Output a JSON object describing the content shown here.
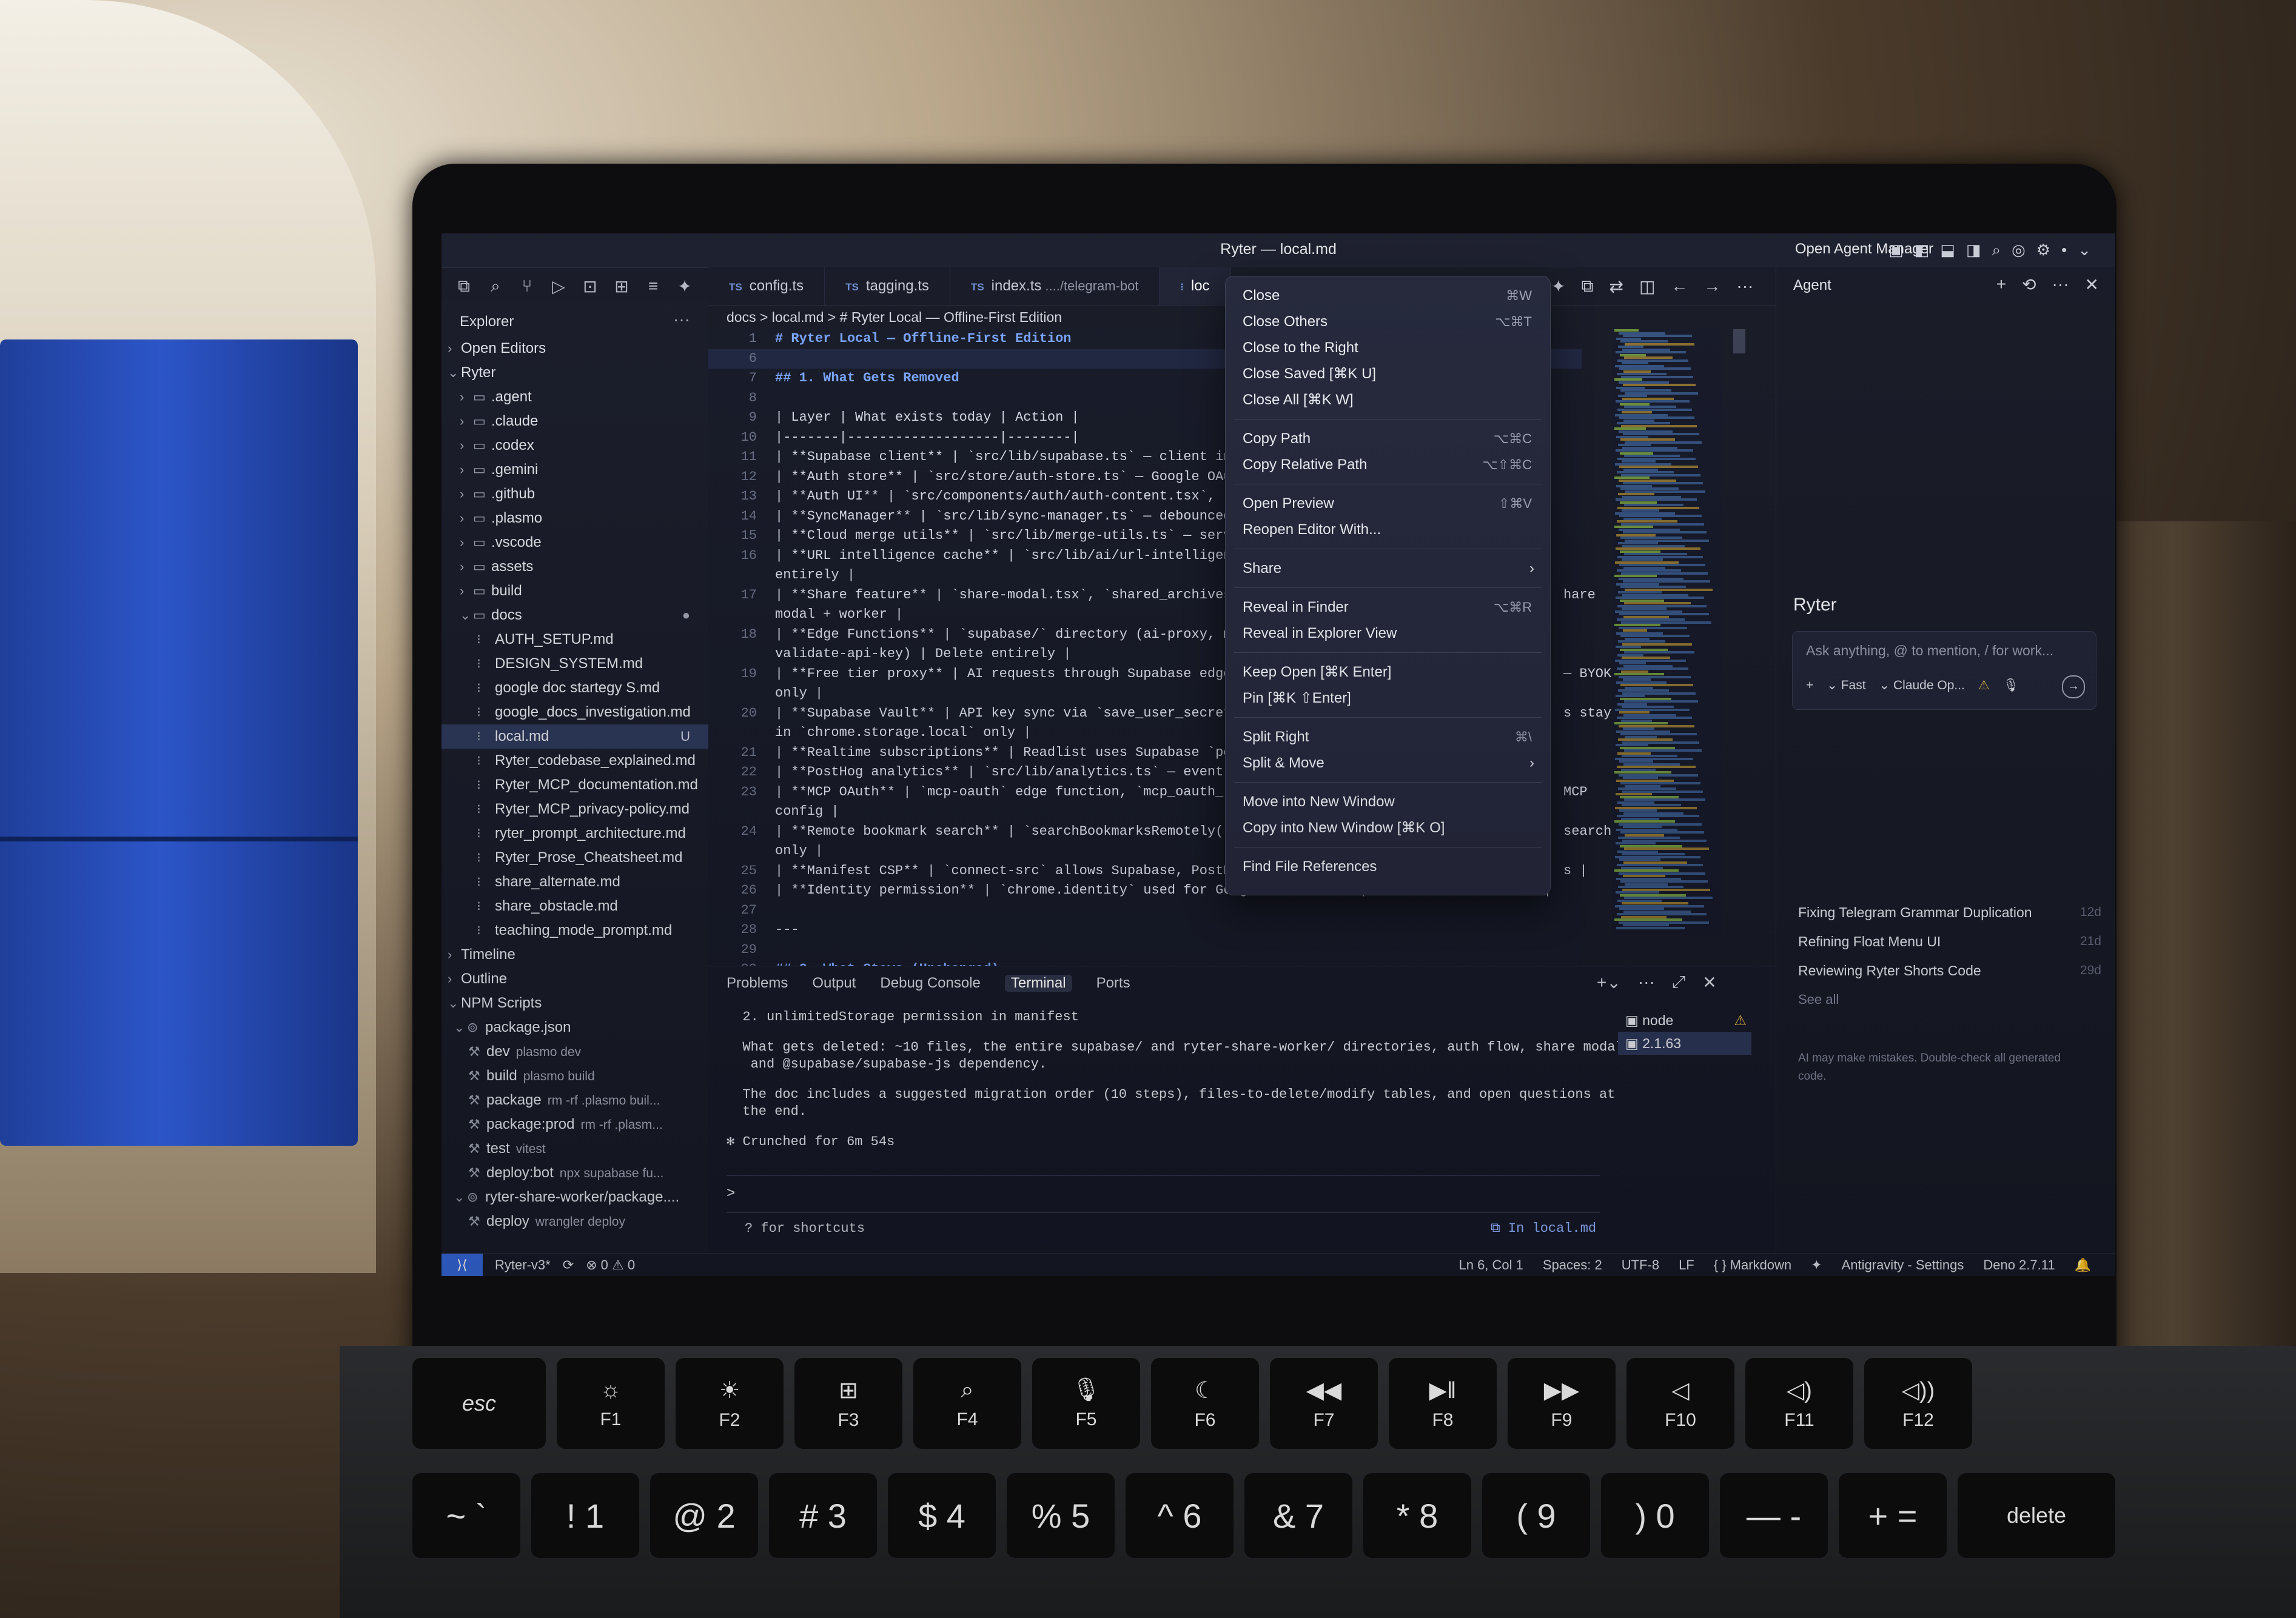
{
  "window": {
    "title": "Ryter — local.md",
    "agent_manager": "Open Agent Manager"
  },
  "sidebar": {
    "header": "Explorer",
    "open_editors": "Open Editors",
    "root": "Ryter",
    "folders": [
      ".agent",
      ".claude",
      ".codex",
      ".gemini",
      ".github",
      ".plasmo",
      ".vscode",
      "assets",
      "build"
    ],
    "docs_folder": "docs",
    "docs_files": [
      "AUTH_SETUP.md",
      "DESIGN_SYSTEM.md",
      "google doc startegy S.md",
      "google_docs_investigation.md",
      "local.md",
      "Ryter_codebase_explained.md",
      "Ryter_MCP_documentation.md",
      "Ryter_MCP_privacy-policy.md",
      "ryter_prompt_architecture.md",
      "Ryter_Prose_Cheatsheet.md",
      "share_alternate.md",
      "share_obstacle.md",
      "teaching_mode_prompt.md"
    ],
    "local_badge": "U",
    "timeline": "Timeline",
    "outline": "Outline",
    "npm_scripts": "NPM Scripts",
    "package_json": "package.json",
    "scripts": [
      {
        "name": "dev",
        "cmd": "plasmo dev"
      },
      {
        "name": "build",
        "cmd": "plasmo build"
      },
      {
        "name": "package",
        "cmd": "rm -rf .plasmo buil..."
      },
      {
        "name": "package:prod",
        "cmd": "rm -rf .plasm..."
      },
      {
        "name": "test",
        "cmd": "vitest"
      },
      {
        "name": "deploy:bot",
        "cmd": "npx supabase fu..."
      }
    ],
    "worker_package": "ryter-share-worker/package....",
    "worker_scripts": [
      {
        "name": "deploy",
        "cmd": "wrangler deploy"
      }
    ]
  },
  "tabs": [
    {
      "label": "config.ts",
      "lang": "TS",
      "sub": ""
    },
    {
      "label": "tagging.ts",
      "lang": "TS",
      "sub": ""
    },
    {
      "label": "index.ts",
      "lang": "TS",
      "sub": "..../telegram-bot"
    },
    {
      "label": "loc",
      "lang": "",
      "sub": ""
    }
  ],
  "breadcrumb": "docs > local.md > # Ryter Local — Offline-First Edition",
  "editor": {
    "lines": [
      {
        "n": "1",
        "t": "# Ryter Local — Offline-First Edition",
        "h": true
      },
      {
        "n": "6",
        "t": "",
        "h": false
      },
      {
        "n": "7",
        "t": "## 1. What Gets Removed",
        "h": true
      },
      {
        "n": "8",
        "t": "",
        "h": false
      },
      {
        "n": "9",
        "t": "| Layer | What exists today | Action |",
        "h": false
      },
      {
        "n": "10",
        "t": "|-------|-------------------|--------|",
        "h": false
      },
      {
        "n": "11",
        "t": "| **Supabase client** | `src/lib/supabase.ts` — client in",
        "h": false
      },
      {
        "n": "12",
        "t": "| **Auth store** | `src/store/auth-store.ts` — Google OAu",
        "h": false
      },
      {
        "n": "13",
        "t": "| **Auth UI** | `src/components/auth/auth-content.tsx`, `",
        "h": false
      },
      {
        "n": "14",
        "t": "| **SyncManager** | `src/lib/sync-manager.ts` — debounced",
        "h": false
      },
      {
        "n": "15",
        "t": "| **Cloud merge utils** | `src/lib/merge-utils.ts` — serv",
        "h": false
      },
      {
        "n": "16",
        "t": "| **URL intelligence cache** | `src/lib/ai/url-intelligen",
        "h": false
      },
      {
        "n": "",
        "t": "entirely |",
        "h": false
      },
      {
        "n": "17",
        "t": "| **Share feature** | `share-modal.tsx`, `shared_archives",
        "h": false
      },
      {
        "n": "",
        "t": "modal + worker |",
        "h": false
      },
      {
        "n": "18",
        "t": "| **Edge Functions** | `supabase/` directory (ai-proxy, m",
        "h": false
      },
      {
        "n": "",
        "t": "validate-api-key) | Delete entirely |",
        "h": false
      },
      {
        "n": "19",
        "t": "| **Free tier proxy** | AI requests through Supabase edge",
        "h": false
      },
      {
        "n": "",
        "t": "only |",
        "h": false
      },
      {
        "n": "20",
        "t": "| **Supabase Vault** | API key sync via `save_user_secret",
        "h": false
      },
      {
        "n": "",
        "t": "in `chrome.storage.local` only |",
        "h": false
      },
      {
        "n": "21",
        "t": "| **Realtime subscriptions** | Readlist uses Supabase `po",
        "h": false
      },
      {
        "n": "22",
        "t": "| **PostHog analytics** | `src/lib/analytics.ts` — event",
        "h": false
      },
      {
        "n": "23",
        "t": "| **MCP OAuth** | `mcp-oauth` edge function, `mcp_oauth_",
        "h": false
      },
      {
        "n": "",
        "t": "config |",
        "h": false
      },
      {
        "n": "24",
        "t": "| **Remote bookmark search** | `searchBookmarksRemotely()",
        "h": false
      },
      {
        "n": "",
        "t": "only |",
        "h": false
      },
      {
        "n": "25",
        "t": "| **Manifest CSP** | `connect-src` allows Supabase, PostH",
        "h": false
      },
      {
        "n": "26",
        "t": "| **Identity permission** | `chrome.identity` used for Google OAuth flow | Remove from manifest |",
        "h": false
      },
      {
        "n": "27",
        "t": "",
        "h": false
      },
      {
        "n": "28",
        "t": "---",
        "h": false
      },
      {
        "n": "29",
        "t": "",
        "h": false
      },
      {
        "n": "30",
        "t": "## 2. What Stays (Unchanged)",
        "h": true
      }
    ],
    "overflow_fragments": [
      {
        "line": 17,
        "t": "hare"
      },
      {
        "line": 19,
        "t": "— BYOK"
      },
      {
        "line": 20,
        "t": "s stay"
      },
      {
        "line": 23,
        "t": "MCP"
      },
      {
        "line": 24,
        "t": "search"
      },
      {
        "line": 25,
        "t": "s |"
      }
    ]
  },
  "context_menu": [
    {
      "label": "Close",
      "kb": "⌘W"
    },
    {
      "label": "Close Others",
      "kb": "⌥⌘T"
    },
    {
      "label": "Close to the Right",
      "kb": ""
    },
    {
      "label": "Close Saved [⌘K U]",
      "kb": ""
    },
    {
      "label": "Close All [⌘K W]",
      "kb": ""
    },
    {
      "sep": true
    },
    {
      "label": "Copy Path",
      "kb": "⌥⌘C"
    },
    {
      "label": "Copy Relative Path",
      "kb": "⌥⇧⌘C"
    },
    {
      "sep": true
    },
    {
      "label": "Open Preview",
      "kb": "⇧⌘V"
    },
    {
      "label": "Reopen Editor With...",
      "kb": ""
    },
    {
      "sep": true
    },
    {
      "label": "Share",
      "kb": "",
      "sub": true
    },
    {
      "sep": true
    },
    {
      "label": "Reveal in Finder",
      "kb": "⌥⌘R"
    },
    {
      "label": "Reveal in Explorer View",
      "kb": ""
    },
    {
      "sep": true
    },
    {
      "label": "Keep Open [⌘K Enter]",
      "kb": ""
    },
    {
      "label": "Pin [⌘K ⇧Enter]",
      "kb": ""
    },
    {
      "sep": true
    },
    {
      "label": "Split Right",
      "kb": "⌘\\"
    },
    {
      "label": "Split & Move",
      "kb": "",
      "sub": true
    },
    {
      "sep": true
    },
    {
      "label": "Move into New Window",
      "kb": ""
    },
    {
      "label": "Copy into New Window [⌘K O]",
      "kb": ""
    },
    {
      "sep": true
    },
    {
      "label": "Find File References",
      "kb": ""
    }
  ],
  "panel": {
    "tabs": [
      "Problems",
      "Output",
      "Debug Console",
      "Terminal",
      "Ports"
    ],
    "active_tab": "Terminal",
    "terminal_lines": [
      "  2. unlimitedStorage permission in manifest",
      "",
      "  What gets deleted: ~10 files, the entire supabase/ and ryter-share-worker/ directories, auth flow, share modal,",
      "   and @supabase/supabase-js dependency.",
      "",
      "  The doc includes a suggested migration order (10 steps), files-to-delete/modify tables, and open questions at",
      "  the end.",
      "",
      "✻ Crunched for 6m 54s"
    ],
    "prompt": ">",
    "shortcut_hint": "? for shortcuts",
    "in_file": "⧉ In local.md",
    "terminals": [
      {
        "label": "node",
        "warn": true
      },
      {
        "label": "2.1.63",
        "warn": false
      }
    ]
  },
  "status": {
    "branch": "Ryter-v3*",
    "errors": "0",
    "warnings": "0",
    "position": "Ln 6, Col 1",
    "spaces": "Spaces: 2",
    "encoding": "UTF-8",
    "eol": "LF",
    "language": "Markdown",
    "settings": "Antigravity - Settings",
    "runtime": "Deno 2.7.11"
  },
  "agent": {
    "header": "Agent",
    "name": "Ryter",
    "input_placeholder": "Ask anything, @ to mention, / for work...",
    "mode": "Fast",
    "model": "Claude Op...",
    "conversations": [
      {
        "title": "Fixing Telegram Grammar Duplication",
        "age": "12d"
      },
      {
        "title": "Refining Float Menu UI",
        "age": "21d"
      },
      {
        "title": "Reviewing Ryter Shorts Code",
        "age": "29d"
      }
    ],
    "see_all": "See all",
    "disclaimer": "AI may make mistakes. Double-check all generated code."
  },
  "keyboard": {
    "fn_row": [
      {
        "label": "esc",
        "glyph": ""
      },
      {
        "label": "F1",
        "glyph": "☼"
      },
      {
        "label": "F2",
        "glyph": "☀"
      },
      {
        "label": "F3",
        "glyph": "⊞"
      },
      {
        "label": "F4",
        "glyph": "⌕"
      },
      {
        "label": "F5",
        "glyph": "🎙"
      },
      {
        "label": "F6",
        "glyph": "☾"
      },
      {
        "label": "F7",
        "glyph": "◀◀"
      },
      {
        "label": "F8",
        "glyph": "▶‖"
      },
      {
        "label": "F9",
        "glyph": "▶▶"
      },
      {
        "label": "F10",
        "glyph": "◁"
      },
      {
        "label": "F11",
        "glyph": "◁)"
      },
      {
        "label": "F12",
        "glyph": "◁))"
      }
    ],
    "num_row": [
      "~ `",
      "! 1",
      "@ 2",
      "# 3",
      "$ 4",
      "% 5",
      "^ 6",
      "& 7",
      "* 8",
      "( 9",
      ") 0",
      "— -",
      "+ =",
      "delete"
    ]
  }
}
